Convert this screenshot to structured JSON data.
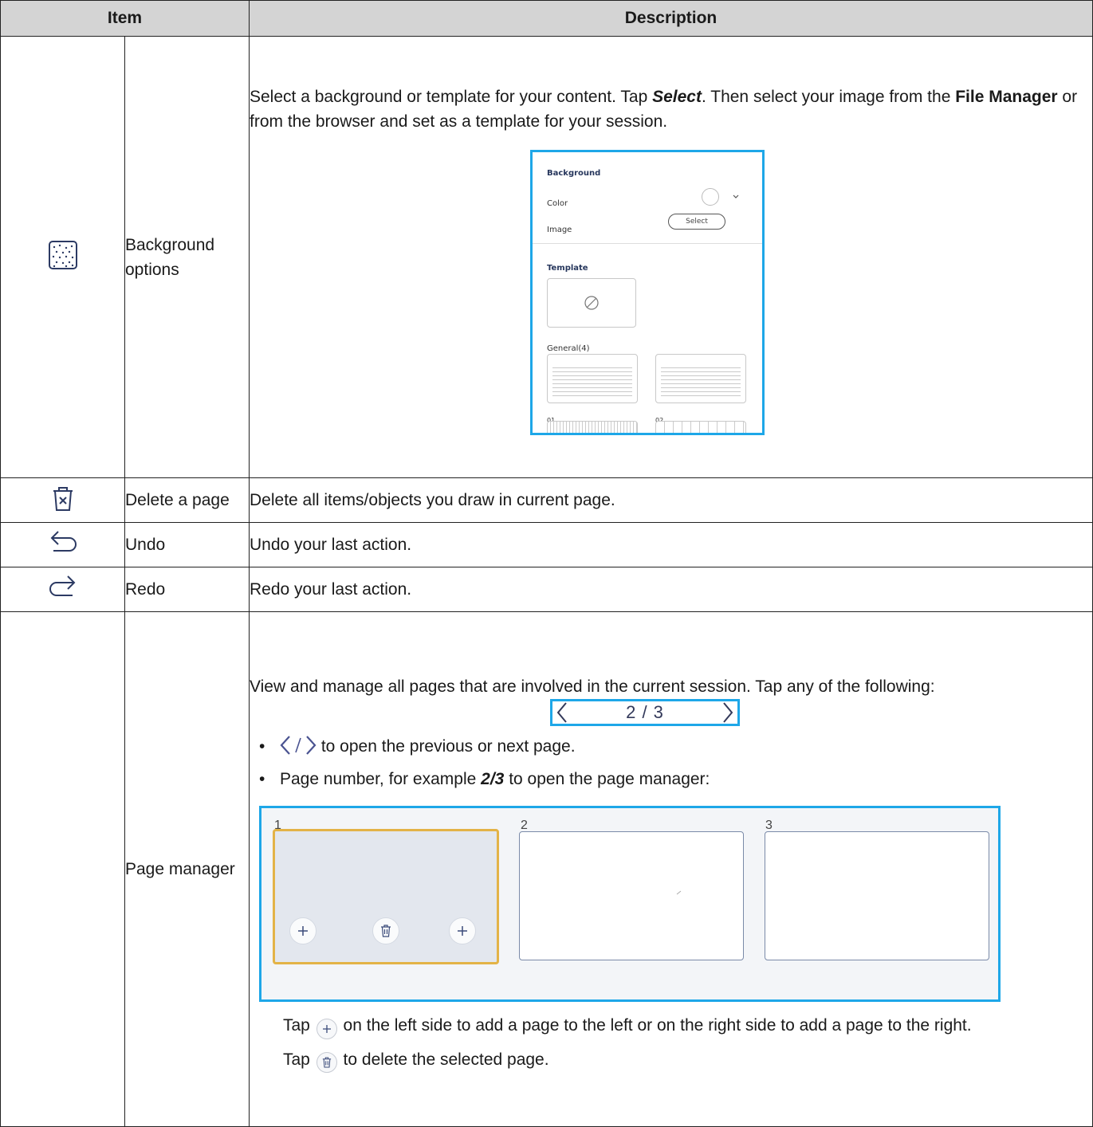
{
  "table": {
    "header": {
      "item": "Item",
      "description": "Description"
    }
  },
  "rows": {
    "background": {
      "icon": "dotted-background-icon",
      "item": "Background options",
      "desc_1": "Select a background or template for your content. Tap ",
      "desc_select": "Select",
      "desc_2": ". Then select your image from the ",
      "desc_file_manager": "File Manager",
      "desc_3": " or from the browser and set as a template for your session.",
      "figure": {
        "background_title": "Background",
        "color_label": "Color",
        "image_label": "Image",
        "select_button": "Select",
        "template_title": "Template",
        "general_label": "General(4)",
        "template_01": "01",
        "template_02": "02"
      }
    },
    "delete": {
      "icon": "trash-x-icon",
      "item": "Delete a page",
      "desc": "Delete all items/objects you draw in current page."
    },
    "undo": {
      "icon": "undo-arrow-icon",
      "item": "Undo",
      "desc": "Undo your last action."
    },
    "redo": {
      "icon": "redo-arrow-icon",
      "item": "Redo",
      "desc": "Redo your last action."
    },
    "page_manager": {
      "item": "Page manager",
      "desc_intro": "View and manage all pages that are involved in the current session. Tap any of the following:",
      "pager_value": "2 / 3",
      "bullet_1_text": " to open the previous or next page.",
      "bullet_2_a": "Page number, for example ",
      "bullet_2_b": "2/3",
      "bullet_2_c": " to open the page manager:",
      "thumb_1": "1",
      "thumb_2": "2",
      "thumb_3": "3",
      "note_1_a": "Tap ",
      "note_1_b": " on the left side to add a page to the left or on the right side to add a page to the right.",
      "note_2_a": "Tap ",
      "note_2_b": " to delete the selected page."
    }
  },
  "colors": {
    "header_bg": "#d4d4d4",
    "highlight_border": "#1ea7e8",
    "selected_page": "#e3b347",
    "icon_navy": "#2c3a63"
  }
}
